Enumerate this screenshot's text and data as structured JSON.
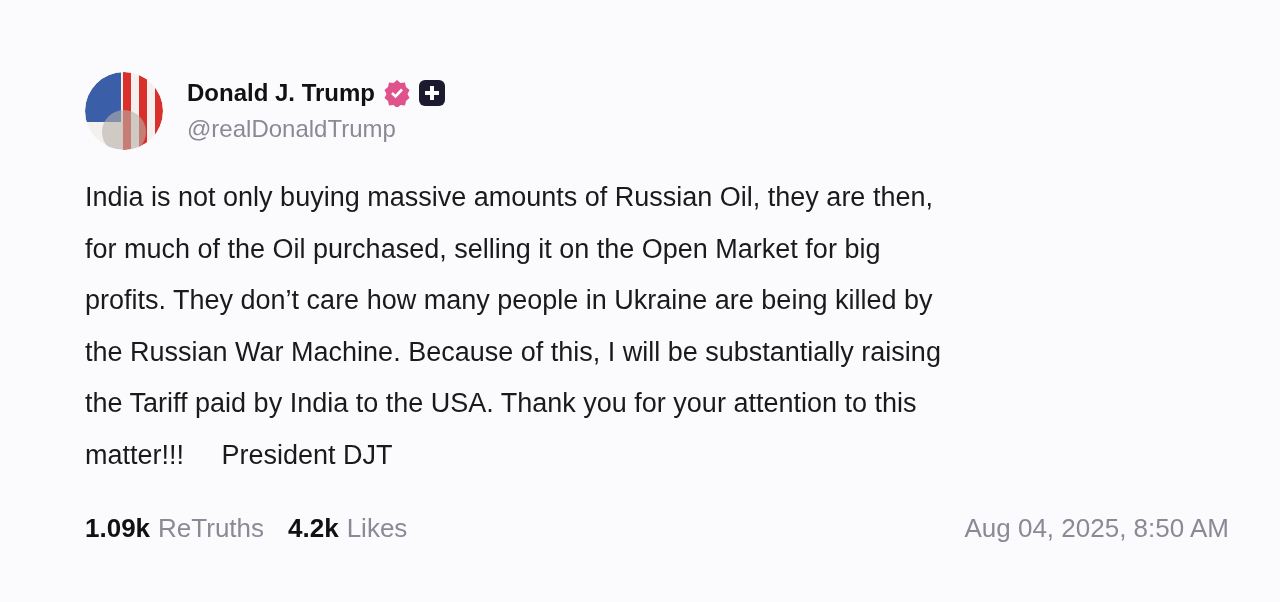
{
  "author": {
    "name": "Donald J. Trump",
    "handle": "@realDonaldTrump",
    "verified": true
  },
  "post": {
    "text": "India is not only buying massive amounts of Russian Oil, they are then,\nfor much of the Oil purchased, selling it on the Open Market for big\nprofits. They don’t care how many people in Ukraine are being killed by\nthe Russian War Machine. Because of this, I will be substantially raising\nthe Tariff paid by India to the USA. Thank you for your attention to this\nmatter!!!     President DJT"
  },
  "stats": [
    {
      "count": "1.09k",
      "label": "ReTruths"
    },
    {
      "count": "4.2k",
      "label": "Likes"
    }
  ],
  "timestamp": "Aug 04, 2025, 8:50 AM"
}
